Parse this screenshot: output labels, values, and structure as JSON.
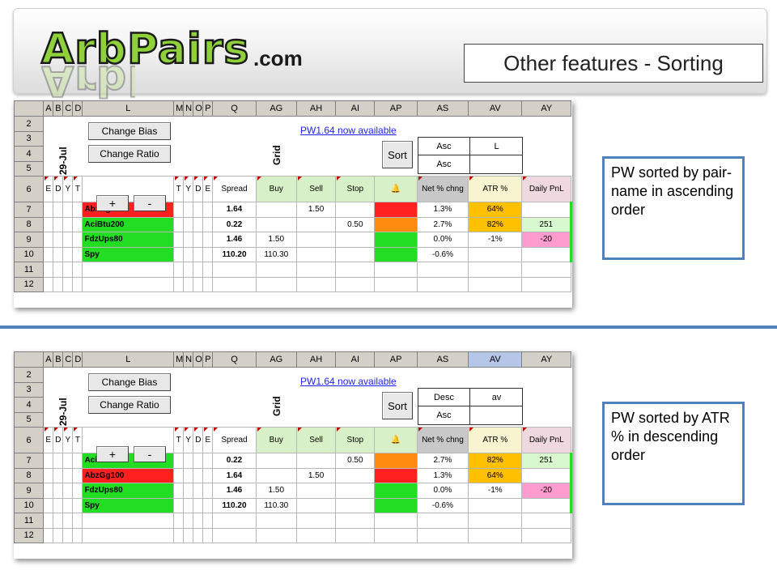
{
  "header": {
    "logo_main": "ArbPairs",
    "logo_suffix": ".com",
    "title": "Other features - Sorting"
  },
  "sheet_columns": [
    "",
    "A",
    "B",
    "C",
    "D",
    "L",
    "M",
    "N",
    "O",
    "P",
    "Q",
    "AG",
    "AH",
    "AI",
    "AP",
    "AS",
    "AV",
    "AY"
  ],
  "sheet_rows": [
    "2",
    "3",
    "4",
    "5",
    "6",
    "7",
    "8",
    "9",
    "10",
    "11",
    "12"
  ],
  "controls": {
    "change_bias": "Change Bias",
    "change_ratio": "Change Ratio",
    "plus": "+",
    "minus": "-",
    "date": "29-Jul",
    "grid": "Grid",
    "notice_link": "PW1.64 now available",
    "sort_button": "Sort"
  },
  "header_row": {
    "left": [
      "E",
      "D",
      "Y",
      "T"
    ],
    "right": [
      "T",
      "Y",
      "D",
      "E"
    ],
    "spread": "Spread",
    "buy": "Buy",
    "sell": "Sell",
    "stop": "Stop",
    "bell": "🔔",
    "net_chng": "Net % chng",
    "atr": "ATR %",
    "daily_pnl": "Daily PnL"
  },
  "panel1": {
    "sort_order_1": "Asc",
    "sort_key_1": "L",
    "sort_order_2": "Asc",
    "note": "PW sorted by pair-name in ascending order",
    "rows": [
      {
        "name": "AbzGg100",
        "name_color": "red",
        "spread": "1.64",
        "buy": "",
        "sell": "1.50",
        "stop": "",
        "status": "red",
        "net": "1.3%",
        "atr": "64%",
        "atr_hl": true,
        "pnl": "",
        "pnl_color": ""
      },
      {
        "name": "AciBtu200",
        "name_color": "green",
        "spread": "0.22",
        "buy": "",
        "sell": "",
        "stop": "0.50",
        "status": "orange",
        "net": "2.7%",
        "atr": "82%",
        "atr_hl": true,
        "pnl": "251",
        "pnl_color": "green"
      },
      {
        "name": "FdzUps80",
        "name_color": "green",
        "spread": "1.46",
        "buy": "1.50",
        "sell": "",
        "stop": "",
        "status": "green",
        "net": "0.0%",
        "atr": "-1%",
        "atr_hl": false,
        "pnl": "-20",
        "pnl_color": "pink"
      },
      {
        "name": "Spy",
        "name_color": "green",
        "spread": "110.20",
        "buy": "110.30",
        "sell": "",
        "stop": "",
        "status": "green",
        "net": "-0.6%",
        "atr": "",
        "atr_hl": false,
        "pnl": "",
        "pnl_color": ""
      }
    ]
  },
  "panel2": {
    "sort_order_1": "Desc",
    "sort_key_1": "av",
    "sort_order_2": "Asc",
    "note": "PW sorted by ATR % in descending order",
    "rows": [
      {
        "name": "AciBtu200",
        "name_color": "green",
        "spread": "0.22",
        "buy": "",
        "sell": "",
        "stop": "0.50",
        "status": "orange",
        "net": "2.7%",
        "atr": "82%",
        "atr_hl": true,
        "pnl": "251",
        "pnl_color": "green"
      },
      {
        "name": "AbzGg100",
        "name_color": "red",
        "spread": "1.64",
        "buy": "",
        "sell": "1.50",
        "stop": "",
        "status": "red",
        "net": "1.3%",
        "atr": "64%",
        "atr_hl": true,
        "pnl": "",
        "pnl_color": ""
      },
      {
        "name": "FdzUps80",
        "name_color": "green",
        "spread": "1.46",
        "buy": "1.50",
        "sell": "",
        "stop": "",
        "status": "green",
        "net": "0.0%",
        "atr": "-1%",
        "atr_hl": false,
        "pnl": "-20",
        "pnl_color": "pink"
      },
      {
        "name": "Spy",
        "name_color": "green",
        "spread": "110.20",
        "buy": "110.30",
        "sell": "",
        "stop": "",
        "status": "green",
        "net": "-0.6%",
        "atr": "",
        "atr_hl": false,
        "pnl": "",
        "pnl_color": ""
      }
    ]
  },
  "colors": {
    "accent": "#4f81bd",
    "logo_green": "#8fd13a",
    "red": "#ff2020",
    "green": "#22dd22",
    "orange": "#ff8a10",
    "yellow": "#ffc000",
    "pink": "#ff9ccf",
    "link": "#2020ff"
  }
}
